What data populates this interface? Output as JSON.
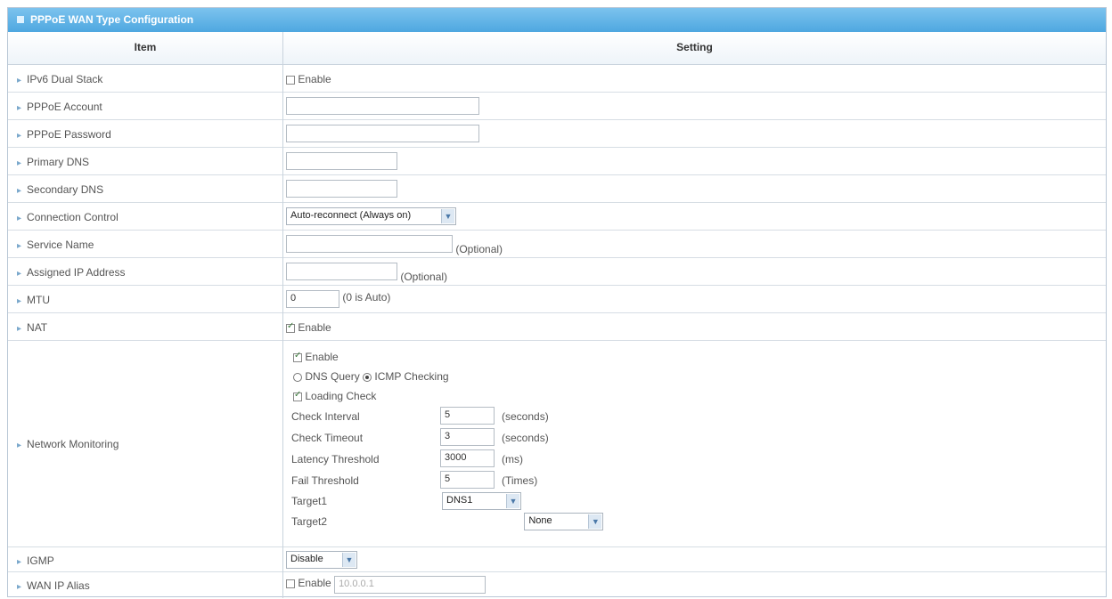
{
  "panel": {
    "title": "PPPoE WAN Type Configuration"
  },
  "header": {
    "item": "Item",
    "setting": "Setting"
  },
  "rows": {
    "ipv6": {
      "label": "IPv6 Dual Stack",
      "enable_label": "Enable",
      "checked": false
    },
    "account": {
      "label": "PPPoE Account",
      "value": ""
    },
    "password": {
      "label": "PPPoE Password",
      "value": ""
    },
    "primary_dns": {
      "label": "Primary DNS",
      "value": ""
    },
    "secondary_dns": {
      "label": "Secondary DNS",
      "value": ""
    },
    "conn_control": {
      "label": "Connection Control",
      "selected": "Auto-reconnect (Always on)"
    },
    "service_name": {
      "label": "Service Name",
      "value": "",
      "hint": "(Optional)"
    },
    "assigned_ip": {
      "label": "Assigned IP Address",
      "value": "",
      "hint": "(Optional)"
    },
    "mtu": {
      "label": "MTU",
      "value": "0",
      "hint": "(0 is Auto)"
    },
    "nat": {
      "label": "NAT",
      "enable_label": "Enable",
      "checked": true
    },
    "monitoring": {
      "label": "Network Monitoring",
      "enable_label": "Enable",
      "enable_checked": true,
      "dns_query": "DNS Query",
      "icmp_checking": "ICMP Checking",
      "selected_method": "ICMP Checking",
      "loading_check": "Loading Check",
      "loading_checked": true,
      "check_interval": {
        "label": "Check Interval",
        "value": "5",
        "unit": "(seconds)"
      },
      "check_timeout": {
        "label": "Check Timeout",
        "value": "3",
        "unit": "(seconds)"
      },
      "latency_threshold": {
        "label": "Latency Threshold",
        "value": "3000",
        "unit": "(ms)"
      },
      "fail_threshold": {
        "label": "Fail Threshold",
        "value": "5",
        "unit": "(Times)"
      },
      "target1": {
        "label": "Target1",
        "selected": "DNS1"
      },
      "target2": {
        "label": "Target2",
        "selected": "None"
      }
    },
    "igmp": {
      "label": "IGMP",
      "selected": "Disable"
    },
    "wan_alias": {
      "label": "WAN IP Alias",
      "enable_label": "Enable",
      "checked": false,
      "value": "10.0.0.1"
    }
  },
  "icons": {
    "dropdown": "chevron-down-icon",
    "row_bullet": "triangle-right-icon"
  },
  "colors": {
    "title_bar": "#4ea7e0",
    "border": "#c9d3dd"
  }
}
